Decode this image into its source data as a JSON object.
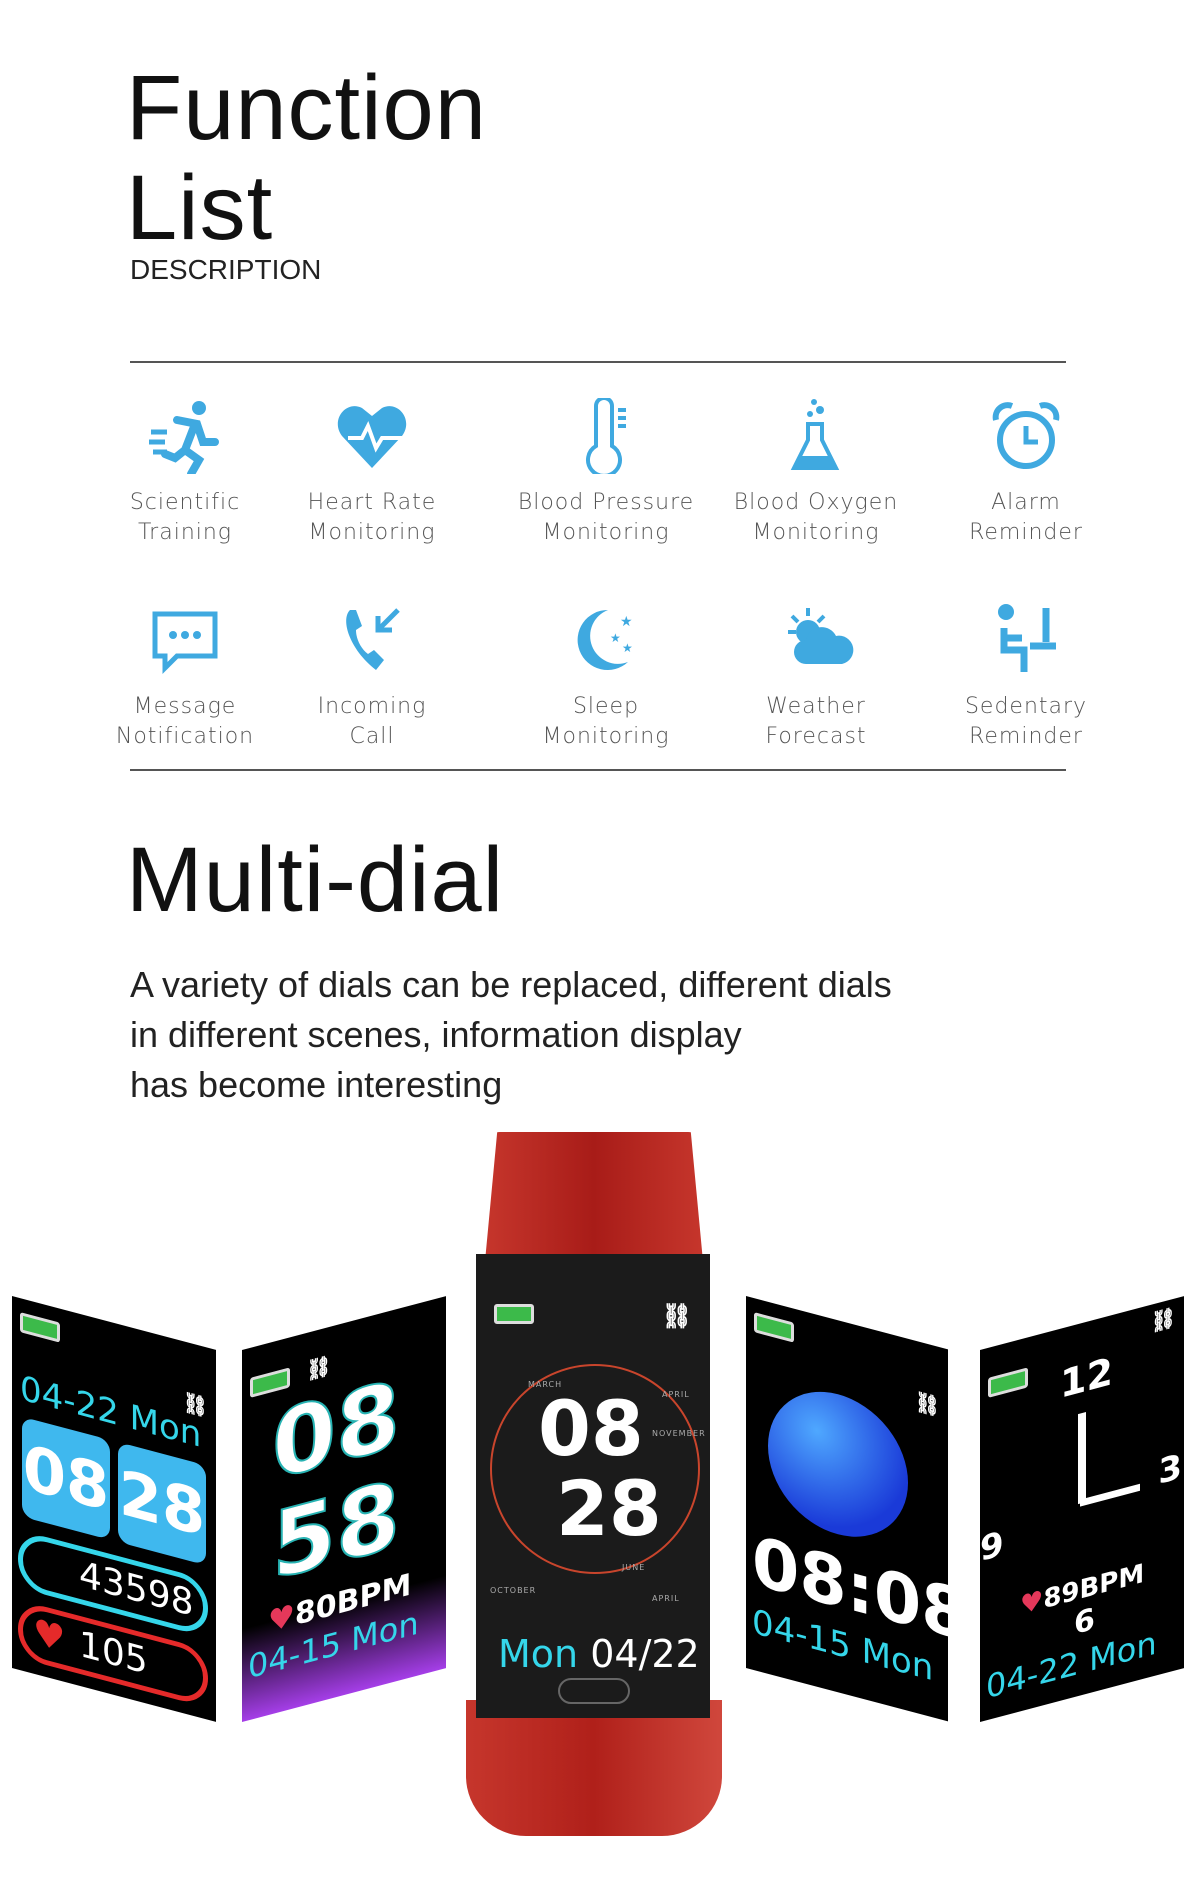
{
  "function_list": {
    "title_line1": "Function",
    "title_line2": "List",
    "subtitle": "DESCRIPTION",
    "accent_color": "#3fa9e0",
    "features": [
      {
        "icon": "running-icon",
        "line1": "Scientific",
        "line2": "Training"
      },
      {
        "icon": "heart-rate-icon",
        "line1": "Heart Rate",
        "line2": "Monitoring"
      },
      {
        "icon": "thermometer-icon",
        "line1": "Blood Pressure",
        "line2": "Monitoring"
      },
      {
        "icon": "flask-icon",
        "line1": "Blood Oxygen",
        "line2": "Monitoring"
      },
      {
        "icon": "alarm-clock-icon",
        "line1": "Alarm",
        "line2": "Reminder"
      },
      {
        "icon": "message-icon",
        "line1": "Message",
        "line2": "Notification"
      },
      {
        "icon": "incoming-call-icon",
        "line1": "Incoming",
        "line2": "Call"
      },
      {
        "icon": "moon-stars-icon",
        "line1": "Sleep",
        "line2": "Monitoring"
      },
      {
        "icon": "weather-icon",
        "line1": "Weather",
        "line2": "Forecast"
      },
      {
        "icon": "sedentary-icon",
        "line1": "Sedentary",
        "line2": "Reminder"
      }
    ]
  },
  "multi_dial": {
    "title": "Multi-dial",
    "line1": "A variety of dials can be replaced, different dials",
    "line2": "in different scenes, information display",
    "line3": "has become interesting"
  },
  "dials": {
    "d1": {
      "date": "04-22 Mon",
      "hour": "08",
      "minute": "28",
      "steps": "43598",
      "heart": "105"
    },
    "d2": {
      "hour": "08",
      "minute": "58",
      "bpm": "80BPM",
      "date": "04-15 Mon"
    },
    "center": {
      "hour": "08",
      "minute": "28",
      "day": "Mon",
      "date": "04/22",
      "months": [
        "MARCH",
        "APRIL",
        "NOVEMBER",
        "JUNE",
        "OCTOBER",
        "APRIL"
      ]
    },
    "d4": {
      "time": "08:08",
      "date": "04-15 Mon"
    },
    "d5": {
      "n12": "12",
      "n3": "3",
      "n9": "9",
      "n6": "6",
      "bpm": "89BPM",
      "date": "04-22 Mon"
    }
  },
  "strap_color": "#c0221c"
}
